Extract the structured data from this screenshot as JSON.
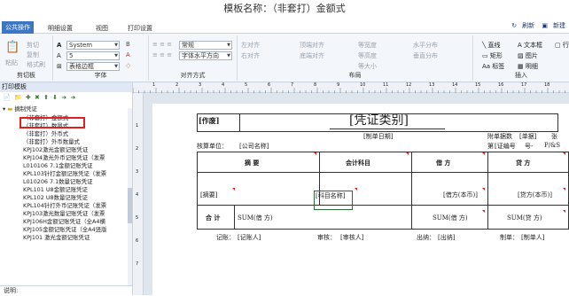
{
  "window": {
    "title": "模板名称：（非套打）金额式"
  },
  "tabs": [
    "公共操作",
    "明细设置",
    "视图",
    "打印设置"
  ],
  "right_links": [
    "刷新",
    "新建"
  ],
  "ribbon": {
    "clipboard": {
      "paste": "粘贴",
      "cut": "剪切",
      "copy": "复制",
      "format": "格式刷",
      "label": "剪切板"
    },
    "font": {
      "name": "System",
      "size": "5",
      "border": "表格边框",
      "label": "字体"
    },
    "align": {
      "normal": "常规",
      "style": "字体水平方向",
      "label": "对齐方式"
    },
    "layout": {
      "items": [
        "左对齐",
        "右对齐",
        "顶端对齐",
        "底端对齐",
        "等宽度",
        "等高度",
        "水平分布",
        "垂直分布",
        "等大小"
      ],
      "label": "布局"
    },
    "insert": {
      "items": [
        "直线",
        "文本框",
        "行",
        "矩形",
        "图片",
        "标签",
        "明细"
      ],
      "label": "插入"
    }
  },
  "left": {
    "title": "打印模板",
    "status": "说明:",
    "tree": [
      "摘制凭证",
      "（非套打）金额式",
      "（非套打）数量式",
      "（非套打）外币式",
      "（非套打）外币数量式",
      "KPJ102激光金额记账凭证",
      "KPJ104激光外币记账凭证（发票",
      "L010106 7.1金额记账凭证",
      "KPL103针打金额记账凭证（发票",
      "L010206 7.1数量记账凭证",
      "KPL101 U8金额记账凭证",
      "KPL102 U8数量记账凭证",
      "KPL104针打外币记账凭证（发票",
      "KPJ103激光数量记账凭证（发票",
      "KPJ106H金额记账凭证（全A4横",
      "KPJ105金额记账凭证（全A4竖版",
      "KPJ101 激光金额记账凭证"
    ]
  },
  "ruler": {
    "h": [
      "1",
      "2",
      "3",
      "4",
      "5",
      "6",
      "7",
      "8",
      "9",
      "10",
      "11",
      "12",
      "13",
      "14",
      "15",
      "16",
      "17",
      "18"
    ],
    "v": [
      "1",
      "2",
      "3",
      "4",
      "5",
      "6",
      "7"
    ]
  },
  "voucher": {
    "void": "[作废]",
    "title": "[凭证类别]",
    "date": "[制单日期]",
    "unit_label": "核算单位：",
    "unit_value": "[公司名称]",
    "attach_label": "附单据数",
    "attach_value": "[单据]",
    "attach_unit": "张",
    "no_label": "第",
    "no_value": "[证编号",
    "no_unit": "号-",
    "page": "P/&S",
    "h1": "摘  要",
    "h2": "会计科目",
    "h3": "借  方",
    "h4": "贷  方",
    "summary": "[摘要]",
    "account": "[科目名称]",
    "debit": "[借方(本币)]",
    "credit": "[贷方(本币)]",
    "total": "合  计",
    "sum_debit1": "SUM(借  方)",
    "sum_debit2": "SUM(借  方)",
    "sum_credit": "SUM(贷  方)",
    "bookkeeper_label": "记账：",
    "bookkeeper": "[记账人]",
    "auditor_label": "审核：",
    "auditor": "[审核人]",
    "cashier_label": "出纳：",
    "cashier": "[出纳]",
    "maker_label": "制单：",
    "maker": "[制单人]"
  }
}
